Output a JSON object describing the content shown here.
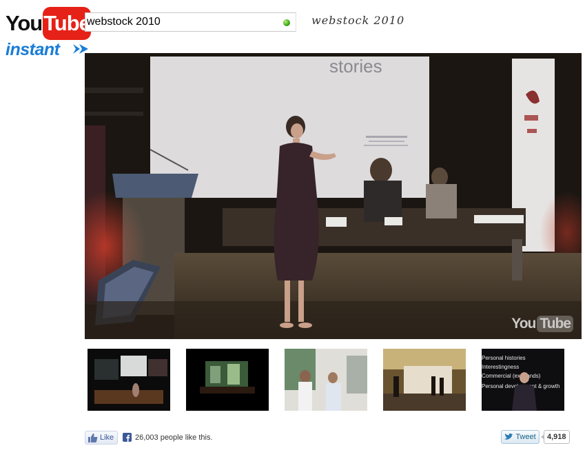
{
  "logo": {
    "you": "You",
    "tube": "Tube",
    "instant": "instant"
  },
  "search": {
    "value": "webstock 2010",
    "status_color": "#3aa516"
  },
  "query_echo": "webstock 2010",
  "player": {
    "watermark_you": "You",
    "watermark_tube": "Tube",
    "slide_text": "stories"
  },
  "thumbnails": [
    {
      "name": "thumb-1"
    },
    {
      "name": "thumb-2"
    },
    {
      "name": "thumb-3"
    },
    {
      "name": "thumb-4"
    },
    {
      "name": "thumb-5",
      "lines": [
        "Personal histories",
        "Interestingness",
        "Commercial (ex brands)",
        "Personal development & growth"
      ]
    }
  ],
  "social": {
    "like_label": "Like",
    "like_text": "26,003 people like this.",
    "tweet_label": "Tweet",
    "tweet_count": "4,918"
  },
  "colors": {
    "youtube_red": "#e62117",
    "instant_blue": "#1a7cd6",
    "facebook_blue": "#3b5998"
  }
}
